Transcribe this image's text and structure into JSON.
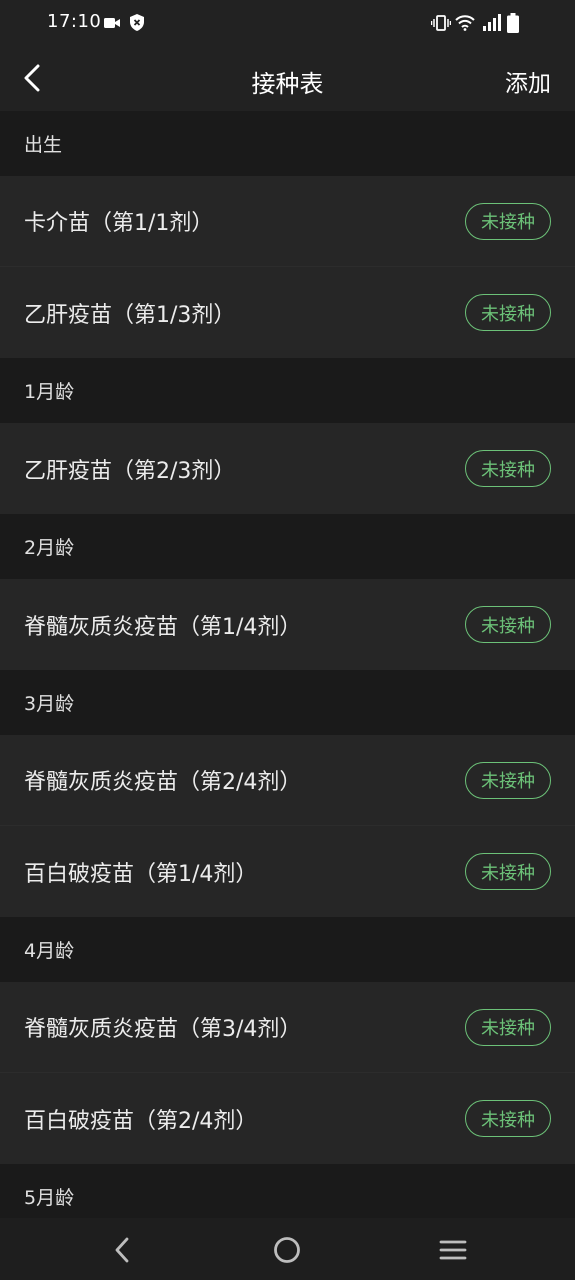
{
  "status_bar": {
    "time": "17:10",
    "left_icons": [
      "video-camera-icon",
      "shield-icon"
    ],
    "right_icons": [
      "vibrate-icon",
      "wifi-icon",
      "signal-icon",
      "battery-icon"
    ]
  },
  "app_bar": {
    "title": "接种表",
    "add_label": "添加",
    "back_icon": "chevron-left-icon"
  },
  "colors": {
    "accent": "#6cc178",
    "background": "#1b1b1b",
    "row_background": "#262626"
  },
  "sections": [
    {
      "label": "出生",
      "items": [
        {
          "name": "卡介苗（第1/1剂）",
          "status": "未接种"
        },
        {
          "name": "乙肝疫苗（第1/3剂）",
          "status": "未接种"
        }
      ]
    },
    {
      "label": "1月龄",
      "items": [
        {
          "name": "乙肝疫苗（第2/3剂）",
          "status": "未接种"
        }
      ]
    },
    {
      "label": "2月龄",
      "items": [
        {
          "name": "脊髓灰质炎疫苗（第1/4剂）",
          "status": "未接种"
        }
      ]
    },
    {
      "label": "3月龄",
      "items": [
        {
          "name": "脊髓灰质炎疫苗（第2/4剂）",
          "status": "未接种"
        },
        {
          "name": "百白破疫苗（第1/4剂）",
          "status": "未接种"
        }
      ]
    },
    {
      "label": "4月龄",
      "items": [
        {
          "name": "脊髓灰质炎疫苗（第3/4剂）",
          "status": "未接种"
        },
        {
          "name": "百白破疫苗（第2/4剂）",
          "status": "未接种"
        }
      ]
    },
    {
      "label": "5月龄",
      "items": []
    }
  ],
  "nav_bar": {
    "buttons": [
      "nav-back-icon",
      "nav-home-icon",
      "nav-menu-icon"
    ]
  }
}
